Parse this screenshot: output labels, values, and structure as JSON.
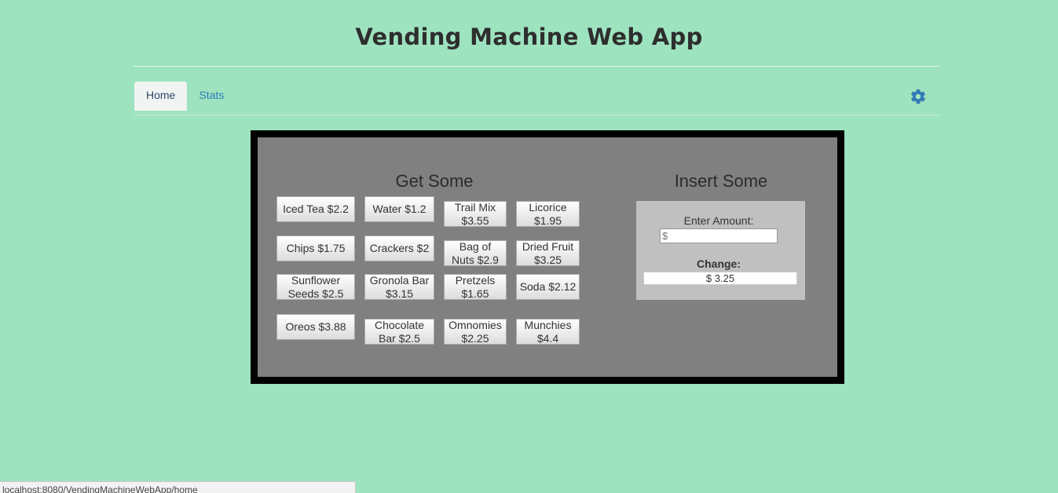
{
  "app": {
    "title": "Vending Machine Web App"
  },
  "nav": {
    "tabs": [
      "Home",
      "Stats"
    ],
    "settings_icon": "gear-icon",
    "accent": "#337ab7"
  },
  "vending": {
    "get_title": "Get Some",
    "insert_title": "Insert Some",
    "products": [
      "Iced Tea $2.2",
      "Water $1.2",
      "Trail Mix $3.55",
      "Licorice $1.95",
      "Chips $1.75",
      "Crackers $2",
      "Bag of Nuts $2.9",
      "Dried Fruit $3.25",
      "Sunflower Seeds $2.5",
      "Gronola Bar $3.15",
      "Pretzels $1.65",
      "Soda $2.12",
      "Oreos $3.88",
      "Chocolate Bar $2.5",
      "Omnomies $2.25",
      "Munchies $4.4"
    ],
    "enter_amount_label": "Enter Amount:",
    "amount_placeholder": "$",
    "amount_value": "",
    "change_label": "Change:",
    "change_value": "$ 3.25"
  },
  "status_bar": {
    "url": "localhost:8080/VendingMachineWebApp/home"
  }
}
